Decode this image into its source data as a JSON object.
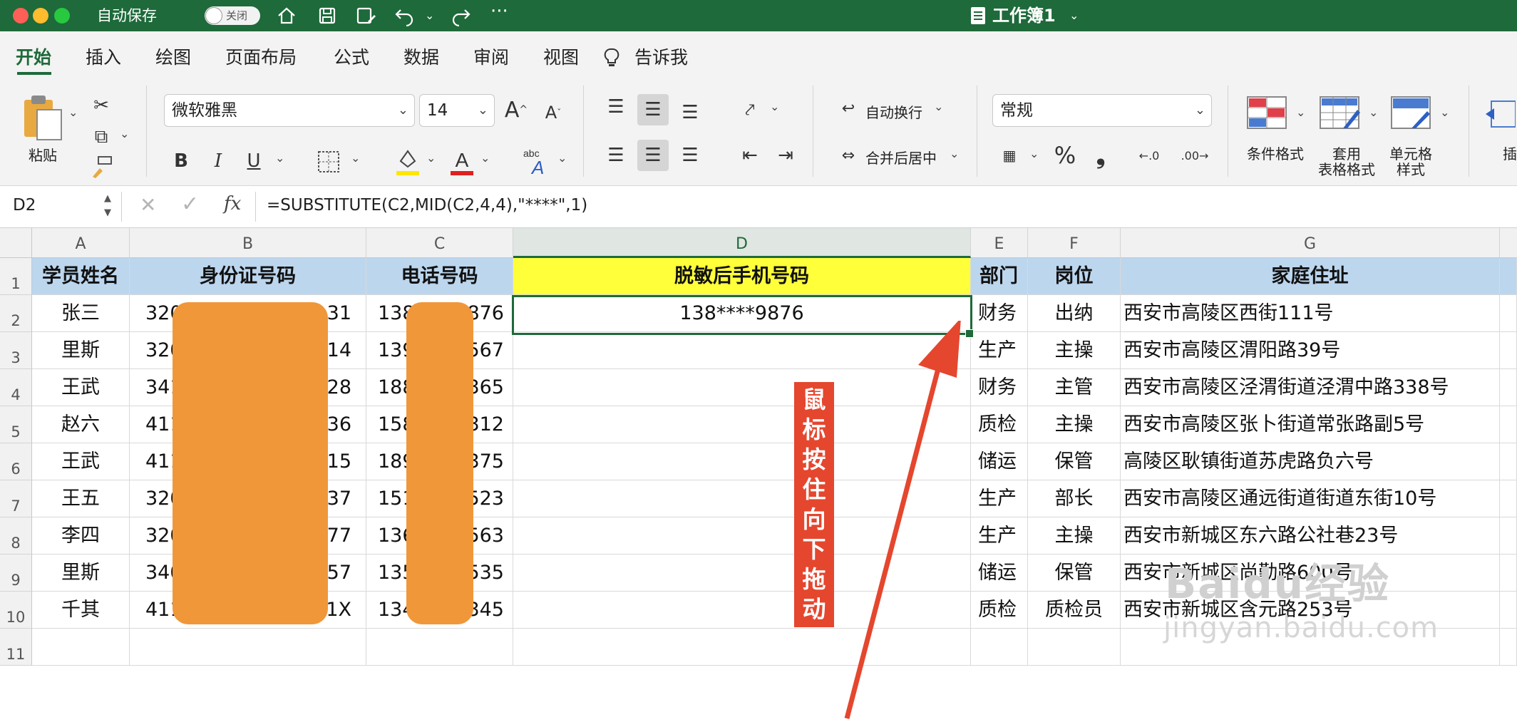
{
  "window": {
    "title": "工作簿1"
  },
  "titlebar": {
    "autosave_label": "自动保存",
    "autosave_toggle": "关闭"
  },
  "tabs": [
    "开始",
    "插入",
    "绘图",
    "页面布局",
    "公式",
    "数据",
    "审阅",
    "视图",
    "告诉我"
  ],
  "ribbon": {
    "paste_label": "粘贴",
    "font_name": "微软雅黑",
    "font_size": "14",
    "wrap_label": "自动换行",
    "merge_label": "合并后居中",
    "number_format": "常规",
    "bold": "B",
    "italic": "I",
    "underline": "U",
    "cond_format_label": "条件格式",
    "table_format_label_1": "套用",
    "table_format_label_2": "表格格式",
    "cell_style_label_1": "单元格",
    "cell_style_label_2": "样式",
    "insert_label_partial": "插",
    "percent": "%",
    "comma": "❟"
  },
  "formula_bar": {
    "name_box": "D2",
    "fx": "fx",
    "formula": "=SUBSTITUTE(C2,MID(C2,4,4),\"****\",1)"
  },
  "columns": [
    "A",
    "B",
    "C",
    "D",
    "E",
    "F",
    "G"
  ],
  "rows": [
    "1",
    "2",
    "3",
    "4",
    "5",
    "6",
    "7",
    "8",
    "9",
    "10",
    "11"
  ],
  "header_row": [
    "学员姓名",
    "身份证号码",
    "电话号码",
    "脱敏后手机号码",
    "部门",
    "岗位",
    "家庭住址"
  ],
  "data_rows": [
    {
      "name": "张三",
      "id_a": "320",
      "id_b": "31",
      "phone_a": "138",
      "phone_b": "876",
      "masked": "138****9876",
      "dept": "财务",
      "post": "出纳",
      "addr": "西安市高陵区西街111号"
    },
    {
      "name": "里斯",
      "id_a": "320",
      "id_b": "14",
      "phone_a": "139",
      "phone_b": "567",
      "masked": "",
      "dept": "生产",
      "post": "主操",
      "addr": "西安市高陵区渭阳路39号"
    },
    {
      "name": "王武",
      "id_a": "341",
      "id_b": "28",
      "phone_a": "188",
      "phone_b": "365",
      "masked": "",
      "dept": "财务",
      "post": "主管",
      "addr": "西安市高陵区泾渭街道泾渭中路338号"
    },
    {
      "name": "赵六",
      "id_a": "411",
      "id_b": "36",
      "phone_a": "158",
      "phone_b": "312",
      "masked": "",
      "dept": "质检",
      "post": "主操",
      "addr": "西安市高陵区张卜街道常张路副5号"
    },
    {
      "name": "王武",
      "id_a": "411",
      "id_b": "15",
      "phone_a": "189",
      "phone_b": "375",
      "masked": "",
      "dept": "储运",
      "post": "保管",
      "addr": "高陵区耿镇街道苏虎路负六号"
    },
    {
      "name": "王五",
      "id_a": "320",
      "id_b": "37",
      "phone_a": "151",
      "phone_b": "523",
      "masked": "",
      "dept": "生产",
      "post": "部长",
      "addr": "西安市高陵区通远街道街道东街10号"
    },
    {
      "name": "李四",
      "id_a": "320",
      "id_b": "77",
      "phone_a": "136",
      "phone_b": "563",
      "masked": "",
      "dept": "生产",
      "post": "主操",
      "addr": "西安市新城区东六路公社巷23号"
    },
    {
      "name": "里斯",
      "id_a": "340",
      "id_b": "57",
      "phone_a": "135",
      "phone_b": "535",
      "masked": "",
      "dept": "储运",
      "post": "保管",
      "addr": "西安市新城区尚勤路600号"
    },
    {
      "name": "千其",
      "id_a": "411",
      "id_b": "1X",
      "phone_a": "134",
      "phone_b": "345",
      "masked": "",
      "dept": "质检",
      "post": "质检员",
      "addr": "西安市新城区含元路253号"
    }
  ],
  "annotation": {
    "text": [
      "鼠",
      "标",
      "按",
      "住",
      "向",
      "下",
      "拖",
      "动"
    ],
    "arrow_color": "#e5462e"
  },
  "watermark": {
    "main": "Baidu经验",
    "sub": "jingyan.baidu.com"
  },
  "colors": {
    "accent": "#1e6a3a",
    "header_fill": "#bcd6ee",
    "highlight_fill": "#ffff3a",
    "redaction": "#f0973a"
  }
}
